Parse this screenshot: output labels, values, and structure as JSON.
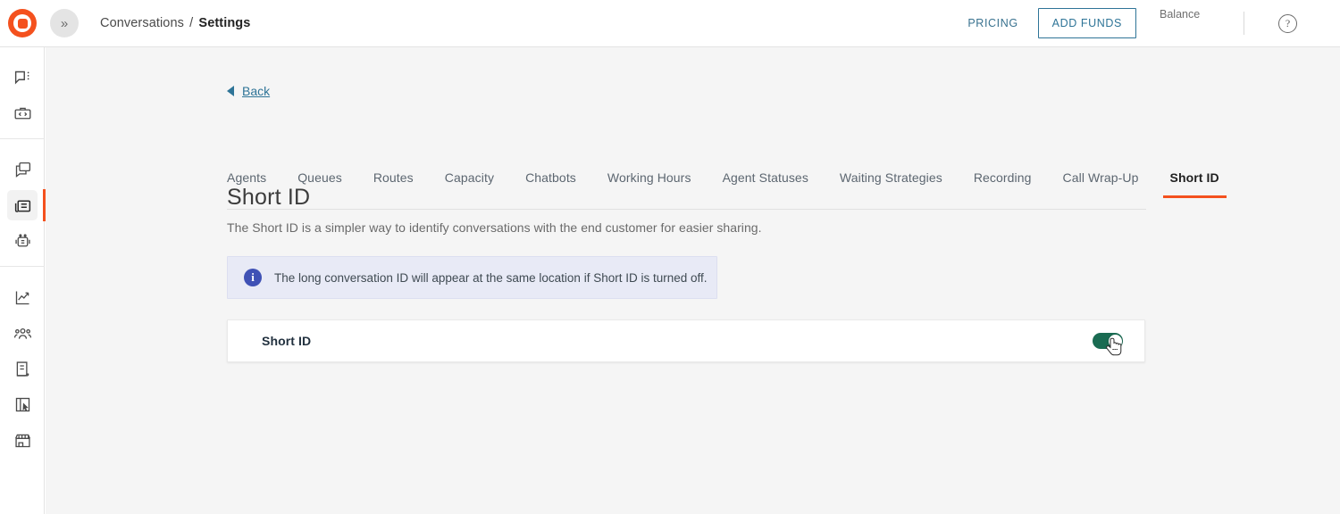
{
  "app": {
    "logo_icon": "brand-target-logo",
    "expand_icon": "double-chevron-right-icon"
  },
  "breadcrumb": {
    "parent": "Conversations",
    "separator": "/",
    "current": "Settings"
  },
  "header": {
    "pricing_label": "PRICING",
    "add_funds_label": "ADD FUNDS",
    "balance_label": "Balance",
    "help_icon": "question-mark-circle-icon",
    "help_glyph": "?"
  },
  "sidebar": {
    "items": [
      {
        "name": "conversations",
        "icon": "chat-bubble-menu-icon",
        "active": false
      },
      {
        "name": "developers",
        "icon": "code-briefcase-icon",
        "active": false
      },
      {
        "name": "campaigns",
        "icon": "copy-message-icon",
        "active": false
      },
      {
        "name": "contact-center",
        "icon": "inbox-drawer-icon",
        "active": true
      },
      {
        "name": "chatbots",
        "icon": "robot-icon",
        "active": false
      },
      {
        "name": "analytics",
        "icon": "line-chart-icon",
        "active": false
      },
      {
        "name": "audience",
        "icon": "people-group-icon",
        "active": false
      },
      {
        "name": "documents",
        "icon": "document-icon",
        "active": false
      },
      {
        "name": "templates",
        "icon": "layout-cursor-icon",
        "active": false
      },
      {
        "name": "marketplace",
        "icon": "storefront-icon",
        "active": false
      }
    ]
  },
  "main": {
    "back_label": "Back",
    "back_icon": "triangle-left-icon",
    "tabs": [
      {
        "label": "Agents",
        "active": false
      },
      {
        "label": "Queues",
        "active": false
      },
      {
        "label": "Routes",
        "active": false
      },
      {
        "label": "Capacity",
        "active": false
      },
      {
        "label": "Chatbots",
        "active": false
      },
      {
        "label": "Working Hours",
        "active": false
      },
      {
        "label": "Agent Statuses",
        "active": false
      },
      {
        "label": "Waiting Strategies",
        "active": false
      },
      {
        "label": "Recording",
        "active": false
      },
      {
        "label": "Call Wrap-Up",
        "active": false
      },
      {
        "label": "Short ID",
        "active": true
      }
    ],
    "page_title": "Short ID",
    "page_description": "The Short ID is a simpler way to identify conversations with the end customer for easier sharing.",
    "info_banner": {
      "icon": "info-circle-icon",
      "glyph": "i",
      "text": "The long conversation ID will appear at the same location if Short ID is turned off."
    },
    "setting_card": {
      "label": "Short ID",
      "toggle_state": "on",
      "toggle_name": "short-id-toggle"
    },
    "cursor": "pointing-hand-cursor"
  },
  "colors": {
    "brand_orange": "#f4511e",
    "link_teal": "#2e7497",
    "toggle_on_green": "#1a6b52",
    "info_blue": "#3f51b5",
    "info_bg": "#e8eaf6",
    "page_bg": "#f5f5f5"
  }
}
